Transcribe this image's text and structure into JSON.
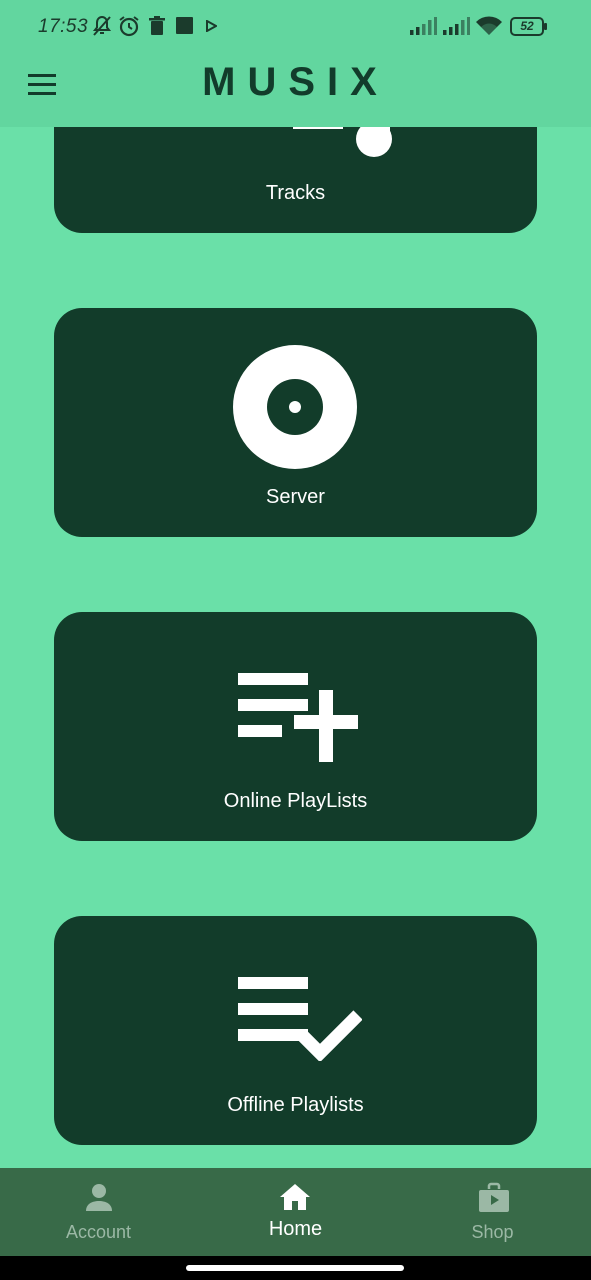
{
  "status_bar": {
    "time": "17:53",
    "battery": "52",
    "icons": [
      "bell-off-icon",
      "alarm-icon",
      "trash-icon",
      "square-icon",
      "play-icon",
      "signal-icon",
      "signal-icon",
      "wifi-icon",
      "battery-icon"
    ]
  },
  "app_bar": {
    "title": "MUSIX",
    "menu_icon": "hamburger-menu-icon"
  },
  "cards": [
    {
      "label": "Tracks",
      "icon": "music-note-icon"
    },
    {
      "label": "Server",
      "icon": "disc-icon"
    },
    {
      "label": "Online PlayLists",
      "icon": "playlist-add-icon"
    },
    {
      "label": "Offline Playlists",
      "icon": "playlist-check-icon"
    }
  ],
  "bottom_nav": {
    "items": [
      {
        "label": "Account",
        "icon": "person-icon",
        "active": false
      },
      {
        "label": "Home",
        "icon": "home-icon",
        "active": true
      },
      {
        "label": "Shop",
        "icon": "shop-icon",
        "active": false
      }
    ]
  },
  "colors": {
    "background": "#6ae0a8",
    "app_bar": "#62d69f",
    "card": "#123c2a",
    "nav_bar": "#386a48",
    "title": "#123c2b"
  }
}
